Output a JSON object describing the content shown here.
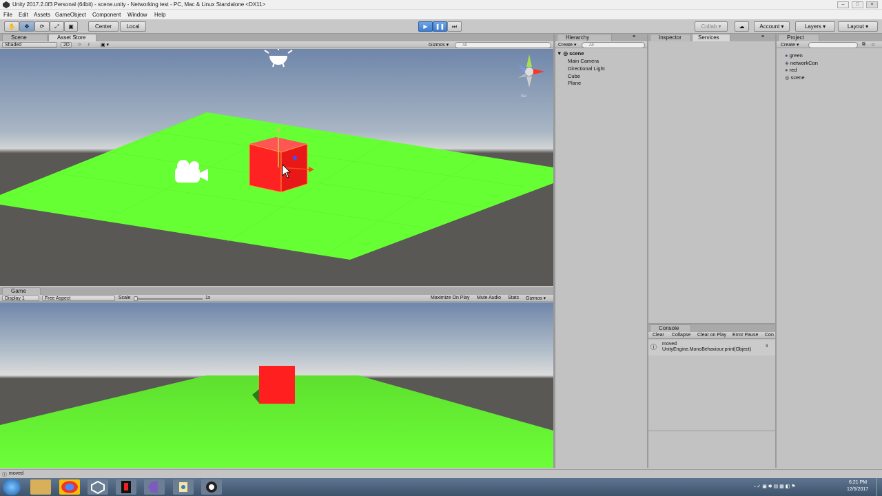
{
  "window": {
    "title": "Unity 2017.2.0f3 Personal (64bit) - scene.unity - Networking test - PC, Mac & Linux Standalone <DX11>"
  },
  "menu": [
    "File",
    "Edit",
    "Assets",
    "GameObject",
    "Component",
    "Window",
    "Help"
  ],
  "toolbar": {
    "center": "Center",
    "local": "Local",
    "collab": "Collab",
    "account": "Account",
    "layers": "Layers",
    "layout": "Layout"
  },
  "scene": {
    "tab_scene": "Scene",
    "tab_asset_store": "Asset Store",
    "shading": "Shaded",
    "mode2d": "2D",
    "gizmos": "Gizmos",
    "search_placeholder": "All",
    "iso": "Iso"
  },
  "game": {
    "tab": "Game",
    "display": "Display 1",
    "aspect": "Free Aspect",
    "scale_label": "Scale",
    "scale_value": "1x",
    "maximize": "Maximize On Play",
    "mute": "Mute Audio",
    "stats": "Stats",
    "gizmos": "Gizmos"
  },
  "hierarchy": {
    "tab": "Hierarchy",
    "create": "Create",
    "search_placeholder": "All",
    "scene": "scene",
    "items": [
      "Main Camera",
      "Directional Light",
      "Cube",
      "Plane"
    ]
  },
  "inspector": {
    "tab": "Inspector",
    "services": "Services"
  },
  "project": {
    "tab": "Project",
    "create": "Create",
    "items": [
      "green",
      "networkCon",
      "red",
      "scene"
    ]
  },
  "console": {
    "tab": "Console",
    "clear": "Clear",
    "collapse": "Collapse",
    "clear_on_play": "Clear on Play",
    "error_pause": "Error Pause",
    "con": "Con",
    "msg1": "moved",
    "msg2": "UnityEngine.MonoBehaviour:print(Object)",
    "count": "3"
  },
  "status": {
    "message": "moved"
  },
  "clock": {
    "time": "6:21 PM",
    "date": "12/5/2017"
  },
  "colors": {
    "green_plane": "#66ff33",
    "red_cube": "#ff2222",
    "sky_top": "#6f86aa",
    "ground": "#5a5855"
  }
}
